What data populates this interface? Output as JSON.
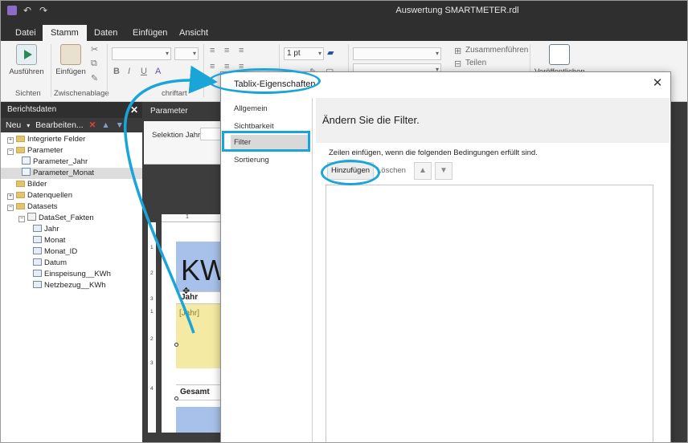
{
  "window": {
    "title": "Auswertung SMARTMETER.rdl"
  },
  "ribbon": {
    "tabs": [
      "Datei",
      "Stamm",
      "Daten",
      "Einfügen",
      "Ansicht"
    ],
    "active_tab": "Stamm",
    "run_label": "Ausführen",
    "views_group": "Sichten",
    "paste_label": "Einfügen",
    "clipboard_group": "Zwischenablage",
    "font_group_partial": "chriftart",
    "border_width": "1 pt",
    "merge_label": "Zusammenführen",
    "split_label": "Teilen",
    "publish_label": "Veröffentlichen"
  },
  "left_panel": {
    "header": "Berichtsdaten",
    "new_label": "Neu",
    "edit_label": "Bearbeiten...",
    "tree": [
      {
        "label": "Integrierte Felder",
        "type": "folder",
        "depth": 0,
        "expander": "+"
      },
      {
        "label": "Parameter",
        "type": "folder",
        "depth": 0,
        "expander": "−"
      },
      {
        "label": "Parameter_Jahr",
        "type": "param",
        "depth": 1
      },
      {
        "label": "Parameter_Monat",
        "type": "param",
        "depth": 1,
        "selected": true
      },
      {
        "label": "Bilder",
        "type": "folder",
        "depth": 0,
        "expander": ""
      },
      {
        "label": "Datenquellen",
        "type": "folder",
        "depth": 0,
        "expander": "+"
      },
      {
        "label": "Datasets",
        "type": "folder",
        "depth": 0,
        "expander": "−"
      },
      {
        "label": "DataSet_Fakten",
        "type": "dataset",
        "depth": 1,
        "expander": "−"
      },
      {
        "label": "Jahr",
        "type": "field",
        "depth": 2
      },
      {
        "label": "Monat",
        "type": "field",
        "depth": 2
      },
      {
        "label": "Monat_ID",
        "type": "field",
        "depth": 2
      },
      {
        "label": "Datum",
        "type": "field",
        "depth": 2
      },
      {
        "label": "Einspeisung__KWh",
        "type": "field",
        "depth": 2
      },
      {
        "label": "Netzbezug__KWh",
        "type": "field",
        "depth": 2
      }
    ]
  },
  "parameter_area": {
    "header": "Parameter",
    "selection_label": "Selektion Jahr"
  },
  "report": {
    "title_fragment": "KW",
    "column_header": "Jahr",
    "cell_expression": "[Jahr]",
    "total_label": "Gesamt",
    "ruler_top_marks": [
      "1"
    ],
    "ruler_left_marks": [
      "1",
      "2",
      "3",
      "4",
      "1",
      "2",
      "3",
      "4"
    ]
  },
  "dialog": {
    "title": "Tablix-Eigenschaften",
    "nav_items": [
      "Allgemein",
      "Sichtbarkeit",
      "Filter",
      "Sortierung"
    ],
    "active_nav": "Filter",
    "heading": "Ändern Sie die Filter.",
    "description": "Zeilen einfügen, wenn die folgenden Bedingungen erfüllt sind.",
    "add_label": "Hinzufügen",
    "delete_label": "Löschen"
  },
  "colors": {
    "highlight": "#1aa5d9",
    "report_blue": "#a8c1ea",
    "report_yellow": "#f5eaa3",
    "dark_chrome": "#2f2f2f"
  }
}
